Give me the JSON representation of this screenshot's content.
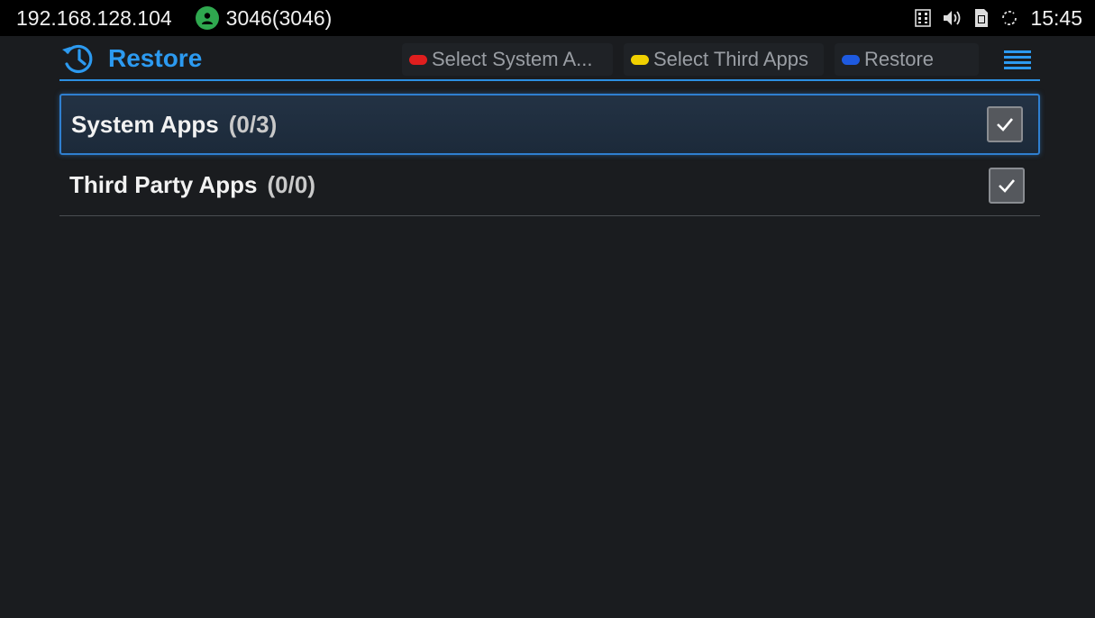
{
  "status_bar": {
    "ip_address": "192.168.128.104",
    "account": "3046(3046)",
    "time": "15:45",
    "icons": [
      "keypad-icon",
      "volume-icon",
      "sim-icon",
      "sync-icon"
    ]
  },
  "header": {
    "title": "Restore",
    "title_icon": "history-icon",
    "softkeys": [
      {
        "label": "Select System A...",
        "color": "#e01e1e"
      },
      {
        "label": "Select Third Apps",
        "color": "#f0d000"
      },
      {
        "label": "Restore",
        "color": "#1e5ae0"
      }
    ],
    "menu_icon": "menu-icon"
  },
  "list": {
    "items": [
      {
        "name": "System Apps",
        "count": "(0/3)",
        "checked": true,
        "selected": true
      },
      {
        "name": "Third Party Apps",
        "count": "(0/0)",
        "checked": true,
        "selected": false
      }
    ]
  },
  "colors": {
    "accent": "#2c9af0",
    "background": "#1a1c1f",
    "account_status": "#2fa84f"
  }
}
